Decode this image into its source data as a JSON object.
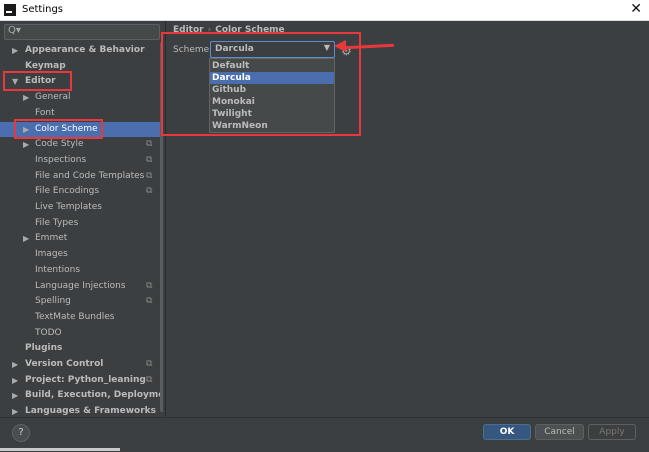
{
  "window": {
    "title": "Settings"
  },
  "search": {
    "placeholder": "Q▾"
  },
  "sidebar": {
    "items": [
      {
        "label": "Appearance & Behavior",
        "arrow": "▶",
        "bold": true
      },
      {
        "label": "Keymap",
        "bold": true
      },
      {
        "label": "Editor",
        "arrow": "▼",
        "bold": true
      },
      {
        "label": "General",
        "arrow": "▶"
      },
      {
        "label": "Font"
      },
      {
        "label": "Color Scheme",
        "arrow": "▶",
        "selected": true
      },
      {
        "label": "Code Style",
        "arrow": "▶",
        "project_icon": true
      },
      {
        "label": "Inspections",
        "project_icon": true
      },
      {
        "label": "File and Code Templates",
        "project_icon": true
      },
      {
        "label": "File Encodings",
        "project_icon": true
      },
      {
        "label": "Live Templates"
      },
      {
        "label": "File Types"
      },
      {
        "label": "Emmet",
        "arrow": "▶"
      },
      {
        "label": "Images"
      },
      {
        "label": "Intentions"
      },
      {
        "label": "Language Injections",
        "project_icon": true
      },
      {
        "label": "Spelling",
        "project_icon": true
      },
      {
        "label": "TextMate Bundles"
      },
      {
        "label": "TODO"
      },
      {
        "label": "Plugins",
        "bold": true
      },
      {
        "label": "Version Control",
        "arrow": "▶",
        "bold": true,
        "project_icon": true
      },
      {
        "label": "Project: Python_leaning",
        "arrow": "▶",
        "bold": true,
        "project_icon": true
      },
      {
        "label": "Build, Execution, Deployment",
        "arrow": "▶",
        "bold": true
      },
      {
        "label": "Languages & Frameworks",
        "arrow": "▶",
        "bold": true
      }
    ]
  },
  "breadcrumb": {
    "parent": "Editor",
    "separator": "›",
    "current": "Color Scheme"
  },
  "scheme": {
    "label": "Scheme:",
    "selected": "Darcula",
    "options": [
      "Default",
      "Darcula",
      "Github",
      "Monokai",
      "Twilight",
      "WarmNeon"
    ]
  },
  "footer": {
    "help": "?",
    "ok": "OK",
    "cancel": "Cancel",
    "apply": "Apply"
  },
  "colors": {
    "accent": "#4b6eaf",
    "annotation": "#e8383d",
    "background": "#3c3f41"
  }
}
